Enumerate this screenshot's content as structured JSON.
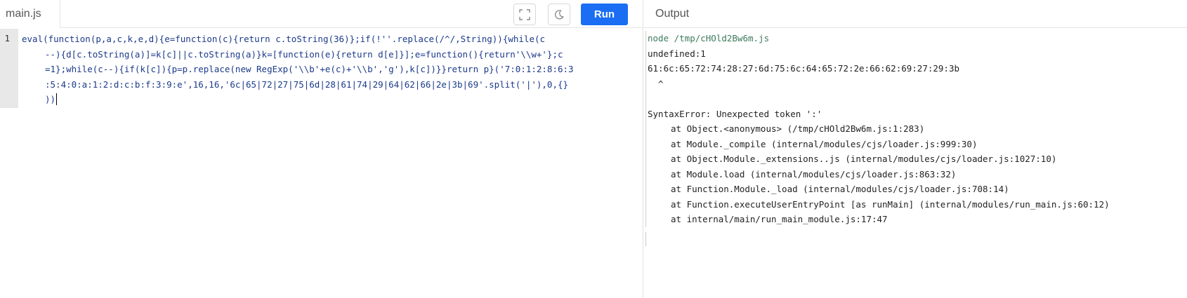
{
  "editor": {
    "file_tab": "main.js",
    "run_label": "Run",
    "line_number": "1",
    "code_lines": [
      "eval(function(p,a,c,k,e,d){e=function(c){return c.toString(36)};if(!''.replace(/^/,String)){while(c",
      "--){d[c.toString(a)]=k[c]||c.toString(a)}k=[function(e){return d[e]}];e=function(){return'\\\\w+'};c",
      "=1};while(c--){if(k[c]){p=p.replace(new RegExp('\\\\b'+e(c)+'\\\\b','g'),k[c])}}return p}('7:0:1:2:8:6:3",
      ":5:4:0:a:1:2:d:c:b:f:3:9:e',16,16,'6c|65|72|27|75|6d|28|61|74|29|64|62|66|2e|3b|69'.split('|'),0,{}",
      "))"
    ],
    "icons": {
      "fullscreen": "fullscreen-icon",
      "theme": "moon-icon"
    }
  },
  "output": {
    "title": "Output",
    "command": "node /tmp/cHOld2Bw6m.js",
    "lines": [
      "undefined:1",
      "61:6c:65:72:74:28:27:6d:75:6c:64:65:72:2e:66:62:69:27:29:3b",
      "  ^",
      "",
      "SyntaxError: Unexpected token ':'"
    ],
    "stack": [
      "at Object.<anonymous> (/tmp/cHOld2Bw6m.js:1:283)",
      "at Module._compile (internal/modules/cjs/loader.js:999:30)",
      "at Object.Module._extensions..js (internal/modules/cjs/loader.js:1027:10)",
      "at Module.load (internal/modules/cjs/loader.js:863:32)",
      "at Function.Module._load (internal/modules/cjs/loader.js:708:14)",
      "at Function.executeUserEntryPoint [as runMain] (internal/modules/run_main.js:60:12)",
      "at internal/main/run_main_module.js:17:47"
    ]
  },
  "colors": {
    "run_button": "#1b6ef3",
    "code_text": "#1b3a8a",
    "command_text": "#3d7a5c"
  }
}
